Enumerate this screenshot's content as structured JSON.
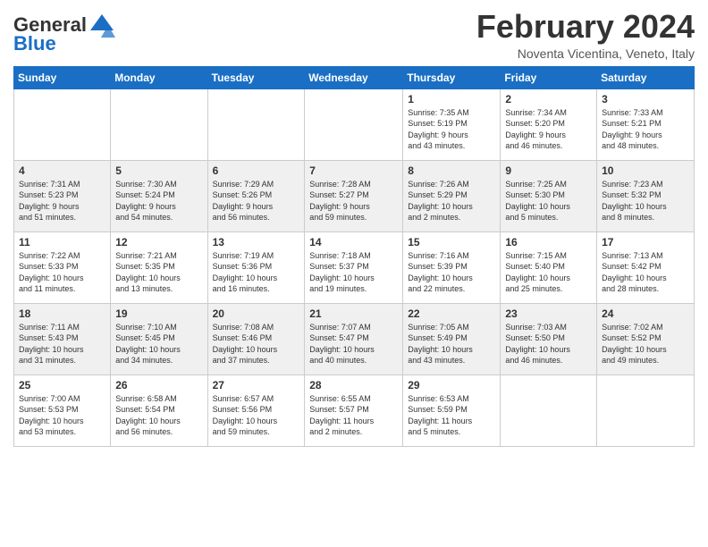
{
  "header": {
    "logo_general": "General",
    "logo_blue": "Blue",
    "month_title": "February 2024",
    "location": "Noventa Vicentina, Veneto, Italy"
  },
  "weekdays": [
    "Sunday",
    "Monday",
    "Tuesday",
    "Wednesday",
    "Thursday",
    "Friday",
    "Saturday"
  ],
  "rows": [
    {
      "cells": [
        {
          "day": "",
          "info": ""
        },
        {
          "day": "",
          "info": ""
        },
        {
          "day": "",
          "info": ""
        },
        {
          "day": "",
          "info": ""
        },
        {
          "day": "1",
          "info": "Sunrise: 7:35 AM\nSunset: 5:19 PM\nDaylight: 9 hours\nand 43 minutes."
        },
        {
          "day": "2",
          "info": "Sunrise: 7:34 AM\nSunset: 5:20 PM\nDaylight: 9 hours\nand 46 minutes."
        },
        {
          "day": "3",
          "info": "Sunrise: 7:33 AM\nSunset: 5:21 PM\nDaylight: 9 hours\nand 48 minutes."
        }
      ]
    },
    {
      "cells": [
        {
          "day": "4",
          "info": "Sunrise: 7:31 AM\nSunset: 5:23 PM\nDaylight: 9 hours\nand 51 minutes."
        },
        {
          "day": "5",
          "info": "Sunrise: 7:30 AM\nSunset: 5:24 PM\nDaylight: 9 hours\nand 54 minutes."
        },
        {
          "day": "6",
          "info": "Sunrise: 7:29 AM\nSunset: 5:26 PM\nDaylight: 9 hours\nand 56 minutes."
        },
        {
          "day": "7",
          "info": "Sunrise: 7:28 AM\nSunset: 5:27 PM\nDaylight: 9 hours\nand 59 minutes."
        },
        {
          "day": "8",
          "info": "Sunrise: 7:26 AM\nSunset: 5:29 PM\nDaylight: 10 hours\nand 2 minutes."
        },
        {
          "day": "9",
          "info": "Sunrise: 7:25 AM\nSunset: 5:30 PM\nDaylight: 10 hours\nand 5 minutes."
        },
        {
          "day": "10",
          "info": "Sunrise: 7:23 AM\nSunset: 5:32 PM\nDaylight: 10 hours\nand 8 minutes."
        }
      ]
    },
    {
      "cells": [
        {
          "day": "11",
          "info": "Sunrise: 7:22 AM\nSunset: 5:33 PM\nDaylight: 10 hours\nand 11 minutes."
        },
        {
          "day": "12",
          "info": "Sunrise: 7:21 AM\nSunset: 5:35 PM\nDaylight: 10 hours\nand 13 minutes."
        },
        {
          "day": "13",
          "info": "Sunrise: 7:19 AM\nSunset: 5:36 PM\nDaylight: 10 hours\nand 16 minutes."
        },
        {
          "day": "14",
          "info": "Sunrise: 7:18 AM\nSunset: 5:37 PM\nDaylight: 10 hours\nand 19 minutes."
        },
        {
          "day": "15",
          "info": "Sunrise: 7:16 AM\nSunset: 5:39 PM\nDaylight: 10 hours\nand 22 minutes."
        },
        {
          "day": "16",
          "info": "Sunrise: 7:15 AM\nSunset: 5:40 PM\nDaylight: 10 hours\nand 25 minutes."
        },
        {
          "day": "17",
          "info": "Sunrise: 7:13 AM\nSunset: 5:42 PM\nDaylight: 10 hours\nand 28 minutes."
        }
      ]
    },
    {
      "cells": [
        {
          "day": "18",
          "info": "Sunrise: 7:11 AM\nSunset: 5:43 PM\nDaylight: 10 hours\nand 31 minutes."
        },
        {
          "day": "19",
          "info": "Sunrise: 7:10 AM\nSunset: 5:45 PM\nDaylight: 10 hours\nand 34 minutes."
        },
        {
          "day": "20",
          "info": "Sunrise: 7:08 AM\nSunset: 5:46 PM\nDaylight: 10 hours\nand 37 minutes."
        },
        {
          "day": "21",
          "info": "Sunrise: 7:07 AM\nSunset: 5:47 PM\nDaylight: 10 hours\nand 40 minutes."
        },
        {
          "day": "22",
          "info": "Sunrise: 7:05 AM\nSunset: 5:49 PM\nDaylight: 10 hours\nand 43 minutes."
        },
        {
          "day": "23",
          "info": "Sunrise: 7:03 AM\nSunset: 5:50 PM\nDaylight: 10 hours\nand 46 minutes."
        },
        {
          "day": "24",
          "info": "Sunrise: 7:02 AM\nSunset: 5:52 PM\nDaylight: 10 hours\nand 49 minutes."
        }
      ]
    },
    {
      "cells": [
        {
          "day": "25",
          "info": "Sunrise: 7:00 AM\nSunset: 5:53 PM\nDaylight: 10 hours\nand 53 minutes."
        },
        {
          "day": "26",
          "info": "Sunrise: 6:58 AM\nSunset: 5:54 PM\nDaylight: 10 hours\nand 56 minutes."
        },
        {
          "day": "27",
          "info": "Sunrise: 6:57 AM\nSunset: 5:56 PM\nDaylight: 10 hours\nand 59 minutes."
        },
        {
          "day": "28",
          "info": "Sunrise: 6:55 AM\nSunset: 5:57 PM\nDaylight: 11 hours\nand 2 minutes."
        },
        {
          "day": "29",
          "info": "Sunrise: 6:53 AM\nSunset: 5:59 PM\nDaylight: 11 hours\nand 5 minutes."
        },
        {
          "day": "",
          "info": ""
        },
        {
          "day": "",
          "info": ""
        }
      ]
    }
  ]
}
